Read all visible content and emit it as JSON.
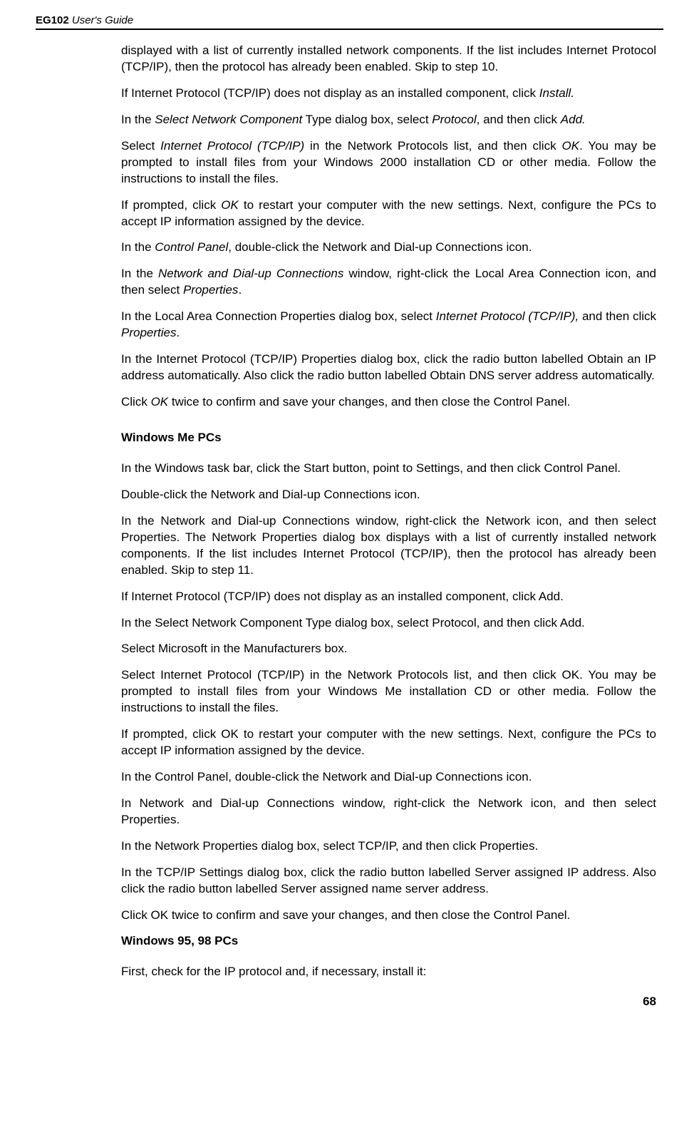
{
  "header": {
    "product": "EG102",
    "subtitle": "User's Guide"
  },
  "paragraphs": {
    "p1_a": "displayed with a list of currently installed network components. If the list includes Internet Protocol (TCP/IP), then the protocol has already been enabled. Skip to step 10.",
    "p2_a": "If Internet Protocol (TCP/IP) does not display as an installed component, click ",
    "p2_b": "Install.",
    "p3_a": "In the ",
    "p3_b": "Select Network Component",
    "p3_c": " Type dialog box, select ",
    "p3_d": "Protocol",
    "p3_e": ", and then click ",
    "p3_f": "Add.",
    "p4_a": "Select ",
    "p4_b": "Internet Protocol (TCP/IP)",
    "p4_c": " in the Network Protocols list, and then click ",
    "p4_d": "OK",
    "p4_e": ". You may be prompted to install files from your Windows 2000 installation CD or other media. Follow the instructions to install the files.",
    "p5_a": "If prompted, click ",
    "p5_b": "OK",
    "p5_c": " to restart your computer with the new settings. Next, configure the PCs to accept IP information assigned by the device.",
    "p6_a": "In the ",
    "p6_b": "Control Panel",
    "p6_c": ", double-click the Network and Dial-up Connections icon.",
    "p7_a": "In the ",
    "p7_b": "Network and Dial-up Connections",
    "p7_c": " window, right-click the Local Area Connection icon, and then select ",
    "p7_d": "Properties",
    "p7_e": ".",
    "p8_a": "In the Local Area Connection Properties dialog box, select ",
    "p8_b": "Internet Protocol (TCP/IP),",
    "p8_c": " and then click ",
    "p8_d": "Properties",
    "p8_e": ".",
    "p9": "In the Internet Protocol (TCP/IP) Properties dialog box, click the radio button labelled Obtain an IP address automatically. Also click the radio button labelled Obtain DNS server address automatically.",
    "p10_a": "Click ",
    "p10_b": "OK",
    "p10_c": " twice to confirm and save your changes, and then close the Control Panel.",
    "heading_me": "Windows Me PCs",
    "p11": "In the Windows task bar, click the Start button, point to Settings, and then click Control Panel.",
    "p12": "Double-click the Network and Dial-up Connections icon.",
    "p13": "In the Network and Dial-up Connections window, right-click the Network icon, and then select Properties. The Network Properties dialog box displays with a list of currently installed network components. If the list includes Internet Protocol (TCP/IP), then the protocol has already been enabled. Skip to step 11.",
    "p14": "If Internet Protocol (TCP/IP) does not display as an installed component, click Add.",
    "p15": "In the Select Network Component Type dialog box, select Protocol, and then click Add.",
    "p16": "Select Microsoft in the Manufacturers box.",
    "p17": "Select Internet Protocol (TCP/IP) in the Network Protocols list, and then click OK. You may be prompted to install files from your Windows Me installation CD or other media. Follow the instructions to install the files.",
    "p18": "If prompted, click OK to restart your computer with the new settings. Next, configure the PCs to accept IP information assigned by the device.",
    "p19": "In the Control Panel, double-click the Network and Dial-up Connections icon.",
    "p20": "In Network and Dial-up Connections window, right-click the Network icon, and then select Properties.",
    "p21": "In the Network Properties dialog box, select TCP/IP, and then click Properties.",
    "p22": "In the TCP/IP Settings dialog box, click the radio button labelled Server assigned IP address. Also click the radio button labelled Server assigned name server address.",
    "p23": "Click OK twice to confirm and save your changes, and then close the Control Panel.",
    "heading_9598": "Windows 95, 98 PCs",
    "p24": "First, check for the IP protocol and, if necessary, install it:"
  },
  "page_number": "68"
}
